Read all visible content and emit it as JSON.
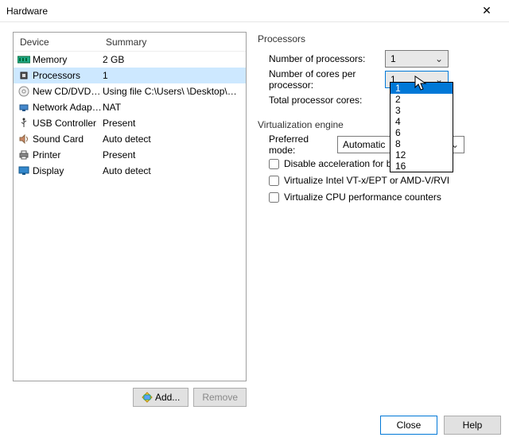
{
  "window": {
    "title": "Hardware"
  },
  "headers": {
    "device": "Device",
    "summary": "Summary"
  },
  "devices": [
    {
      "icon": "memory",
      "name": "Memory",
      "summary": "2 GB"
    },
    {
      "icon": "cpu",
      "name": "Processors",
      "summary": "1"
    },
    {
      "icon": "disc",
      "name": "New CD/DVD (S...",
      "summary": "Using file C:\\Users\\      \\Desktop\\W..."
    },
    {
      "icon": "net",
      "name": "Network Adapter",
      "summary": "NAT"
    },
    {
      "icon": "usb",
      "name": "USB Controller",
      "summary": "Present"
    },
    {
      "icon": "sound",
      "name": "Sound Card",
      "summary": "Auto detect"
    },
    {
      "icon": "printer",
      "name": "Printer",
      "summary": "Present"
    },
    {
      "icon": "display",
      "name": "Display",
      "summary": "Auto detect"
    }
  ],
  "buttons": {
    "add": "Add...",
    "remove": "Remove",
    "close": "Close",
    "help": "Help"
  },
  "proc": {
    "group": "Processors",
    "num_label": "Number of processors:",
    "num_value": "1",
    "cores_label": "Number of cores per processor:",
    "cores_value": "1",
    "total_label": "Total processor cores:"
  },
  "cores_options": [
    "1",
    "2",
    "3",
    "4",
    "6",
    "8",
    "12",
    "16"
  ],
  "virt": {
    "group": "Virtualization engine",
    "mode_label": "Preferred mode:",
    "mode_value": "Automatic",
    "cb1": "Disable acceleration for binary",
    "cb2": "Virtualize Intel VT-x/EPT or AMD-V/RVI",
    "cb3": "Virtualize CPU performance counters"
  }
}
